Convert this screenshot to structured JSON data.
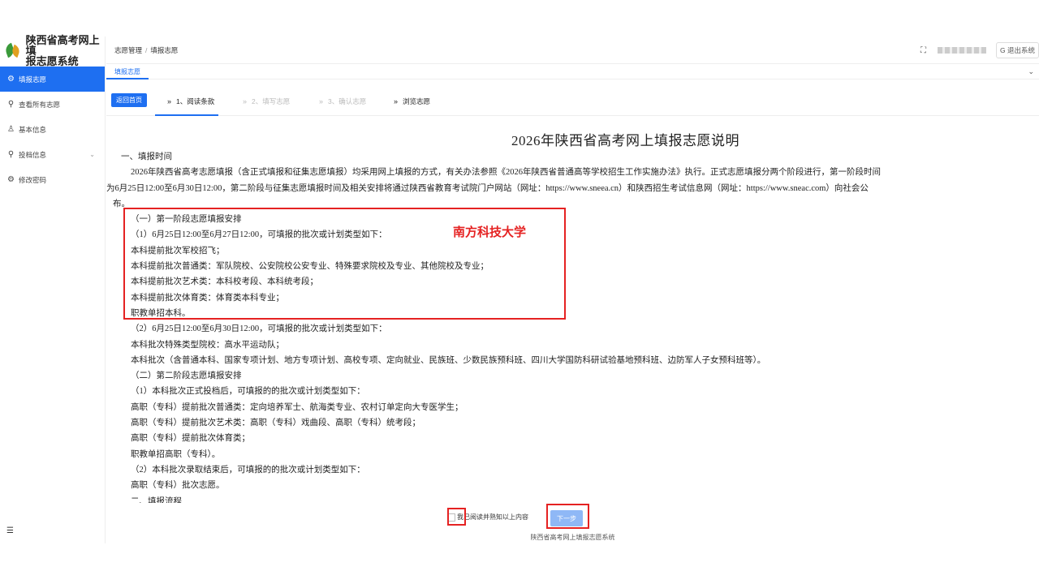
{
  "sidebar": {
    "brand_title_line1": "陕西省高考网上填",
    "brand_title_line2": "报志愿系统",
    "items": [
      {
        "label": "填报志愿",
        "icon": "gear-icon"
      },
      {
        "label": "查看所有志愿",
        "icon": "search-icon"
      },
      {
        "label": "基本信息",
        "icon": "user-icon"
      },
      {
        "label": "投档信息",
        "icon": "search-icon"
      },
      {
        "label": "修改密码",
        "icon": "gear-icon"
      }
    ]
  },
  "header": {
    "breadcrumb_root": "志愿管理",
    "breadcrumb_sep": "/",
    "breadcrumb_current": "填报志愿",
    "logout_label": "退出系统"
  },
  "tabs": {
    "active_label": "填报志愿"
  },
  "steps": {
    "back_label": "返回首页",
    "items": [
      {
        "label": "1、阅读条款"
      },
      {
        "label": "2、填写志愿"
      },
      {
        "label": "3、确认志愿"
      },
      {
        "label": "浏览志愿"
      }
    ]
  },
  "document": {
    "title": "2026年陕西省高考网上填报志愿说明",
    "lines": [
      "一、填报时间",
      "2026年陕西省高考志愿填报（含正式填报和征集志愿填报）均采用网上填报的方式，有关办法参照《2026年陕西省普通高等学校招生工作实施办法》执行。正式志愿填报分两个阶段进行，第一阶段时间",
      "为6月25日12:00至6月30日12:00，第二阶段与征集志愿填报时间及相关安排将通过陕西省教育考试院门户网站（网址：https://www.sneea.cn）和陕西招生考试信息网（网址：https://www.sneac.com）向社会公",
      "布。",
      "（一）第一阶段志愿填报安排",
      "（1）6月25日12:00至6月27日12:00，可填报的批次或计划类型如下：",
      "本科提前批次军校招飞；",
      "本科提前批次普通类：军队院校、公安院校公安专业、特殊要求院校及专业、其他院校及专业；",
      "本科提前批次艺术类：本科校考段、本科统考段；",
      "本科提前批次体育类：体育类本科专业；",
      "职教单招本科。",
      "（2）6月25日12:00至6月30日12:00，可填报的批次或计划类型如下：",
      "本科批次特殊类型院校：高水平运动队；",
      "本科批次（含普通本科、国家专项计划、地方专项计划、高校专项、定向就业、民族班、少数民族预科班、四川大学国防科研试验基地预科班、边防军人子女预科班等）。",
      "（二）第二阶段志愿填报安排",
      "（1）本科批次正式投档后，可填报的的批次或计划类型如下：",
      "高职（专科）提前批次普通类：定向培养军士、航海类专业、农村订单定向大专医学生；",
      "高职（专科）提前批次艺术类：高职（专科）戏曲段、高职（专科）统考段；",
      "高职（专科）提前批次体育类；",
      "职教单招高职（专科）。",
      "（2）本科批次录取结束后，可填报的的批次或计划类型如下：",
      "高职（专科）批次志愿。",
      "二、填报流程"
    ]
  },
  "annotation": {
    "label": "南方科技大学"
  },
  "footer": {
    "agree_label": "我已阅读并熟知以上内容",
    "next_label": "下一步",
    "system_name": "陕西省高考网上填报志愿系统"
  },
  "colors": {
    "primary": "#1e6ff1",
    "annotation_red": "#e52222"
  }
}
